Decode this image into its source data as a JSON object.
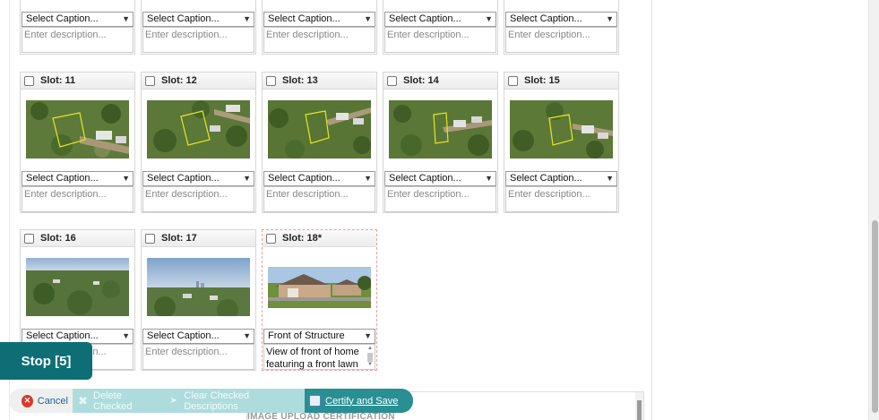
{
  "top_row": [
    {
      "caption": "Select Caption...",
      "desc_placeholder": "Enter description..."
    },
    {
      "caption": "Select Caption...",
      "desc_placeholder": "Enter description..."
    },
    {
      "caption": "Select Caption...",
      "desc_placeholder": "Enter description..."
    },
    {
      "caption": "Select Caption...",
      "desc_placeholder": "Enter description..."
    },
    {
      "caption": "Select Caption...",
      "desc_placeholder": "Enter description..."
    }
  ],
  "slots": [
    {
      "label": "Slot: 11",
      "caption": "Select Caption...",
      "description": "Enter description...",
      "image": "aerial-lot-outline"
    },
    {
      "label": "Slot: 12",
      "caption": "Select Caption...",
      "description": "Enter description...",
      "image": "aerial-lot-outline"
    },
    {
      "label": "Slot: 13",
      "caption": "Select Caption...",
      "description": "Enter description...",
      "image": "aerial-lot-outline"
    },
    {
      "label": "Slot: 14",
      "caption": "Select Caption...",
      "description": "Enter description...",
      "image": "aerial-lot-outline"
    },
    {
      "label": "Slot: 15",
      "caption": "Select Caption...",
      "description": "Enter description...",
      "image": "aerial-lot-outline"
    },
    {
      "label": "Slot: 16",
      "caption": "Select Caption...",
      "description": "Enter description...",
      "image": "aerial-neighborhood"
    },
    {
      "label": "Slot: 17",
      "caption": "Select Caption...",
      "description": "Enter description...",
      "image": "aerial-skyline"
    },
    {
      "label": "Slot: 18*",
      "caption": "Front of Structure",
      "description": "View of front of home featuring a front lawn",
      "image": "house-front"
    }
  ],
  "stop_button": "Stop [5]",
  "toolbar": {
    "cancel": "Cancel",
    "delete_checked": "Delete Checked",
    "clear_checked": "Clear Checked Descriptions",
    "certify": "Certify and Save"
  },
  "certification_heading": "IMAGE UPLOAD CERTIFICATION",
  "colors": {
    "accent": "#2a8f93",
    "stop": "#0d6f75",
    "disabled": "#aedcdc",
    "cancel_icon": "#d9382e"
  }
}
